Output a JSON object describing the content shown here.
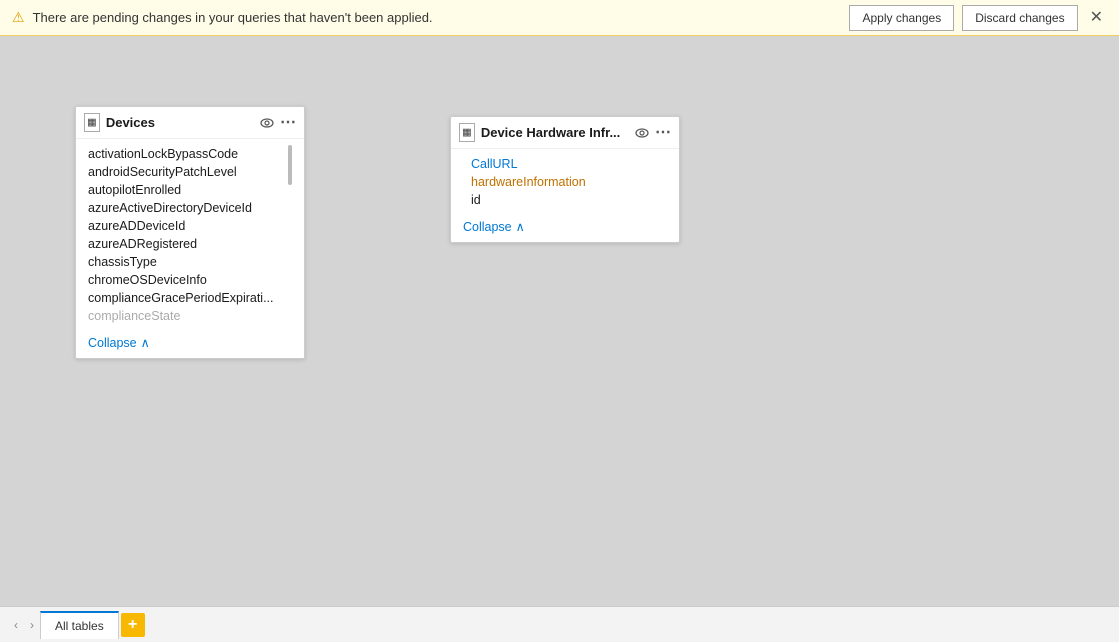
{
  "notification": {
    "message": "There are pending changes in your queries that haven't been applied.",
    "apply_label": "Apply changes",
    "discard_label": "Discard changes",
    "warn_icon": "⚠",
    "close_icon": "✕"
  },
  "devices_card": {
    "title": "Devices",
    "table_icon": "▦",
    "eye_icon": "👁",
    "more_icon": "⋯",
    "fields": [
      {
        "name": "activationLockBypassCode",
        "type": "normal"
      },
      {
        "name": "androidSecurityPatchLevel",
        "type": "normal"
      },
      {
        "name": "autopilotEnrolled",
        "type": "normal"
      },
      {
        "name": "azureActiveDirectoryDeviceId",
        "type": "normal"
      },
      {
        "name": "azureADDeviceId",
        "type": "normal"
      },
      {
        "name": "azureADRegistered",
        "type": "normal"
      },
      {
        "name": "chassisType",
        "type": "normal"
      },
      {
        "name": "chromeOSDeviceInfo",
        "type": "normal"
      },
      {
        "name": "complianceGracePeriodExpirati...",
        "type": "normal"
      },
      {
        "name": "complianceState",
        "type": "normal"
      }
    ],
    "collapse_label": "Collapse",
    "collapse_icon": "∧"
  },
  "hardware_card": {
    "title": "Device Hardware Infr...",
    "table_icon": "▦",
    "eye_icon": "👁",
    "more_icon": "⋯",
    "fields": [
      {
        "name": "CallURL",
        "type": "linked-blue"
      },
      {
        "name": "hardwareInformation",
        "type": "linked"
      },
      {
        "name": "id",
        "type": "normal"
      }
    ],
    "collapse_label": "Collapse",
    "collapse_icon": "∧"
  },
  "bottom_bar": {
    "tab_label": "All tables",
    "add_icon": "+",
    "prev_icon": "‹",
    "next_icon": "›"
  }
}
